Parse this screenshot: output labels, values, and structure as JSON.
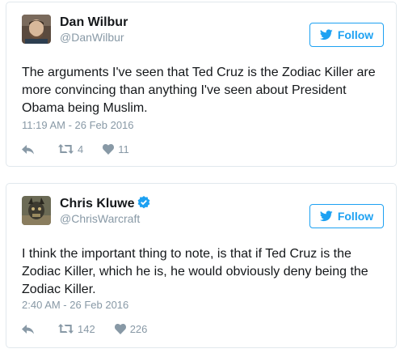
{
  "tweets": [
    {
      "name": "Dan Wilbur",
      "handle": "@DanWilbur",
      "follow_label": "Follow",
      "text": "The arguments I've seen that Ted Cruz is the Zodiac Killer are more convincing than anything I've seen about President Obama being Muslim.",
      "timestamp": "11:19 AM - 26 Feb 2016",
      "retweets": "4",
      "likes": "11",
      "verified": false
    },
    {
      "name": "Chris Kluwe",
      "handle": "@ChrisWarcraft",
      "follow_label": "Follow",
      "text": "I think the important thing to note, is that if Ted Cruz is the Zodiac Killer, which he is, he would obviously deny being the Zodiac Killer.",
      "timestamp": "2:40 AM - 26 Feb 2016",
      "retweets": "142",
      "likes": "226",
      "verified": true
    }
  ],
  "icons": {
    "follow": "twitter-bird-icon",
    "reply": "reply-arrow-icon",
    "retweet": "retweet-icon",
    "like": "heart-icon",
    "verified": "verified-badge-icon"
  },
  "colors": {
    "accent": "#1da1f2",
    "muted": "#8899a6",
    "text": "#14171a",
    "border": "#e1e8ed"
  }
}
